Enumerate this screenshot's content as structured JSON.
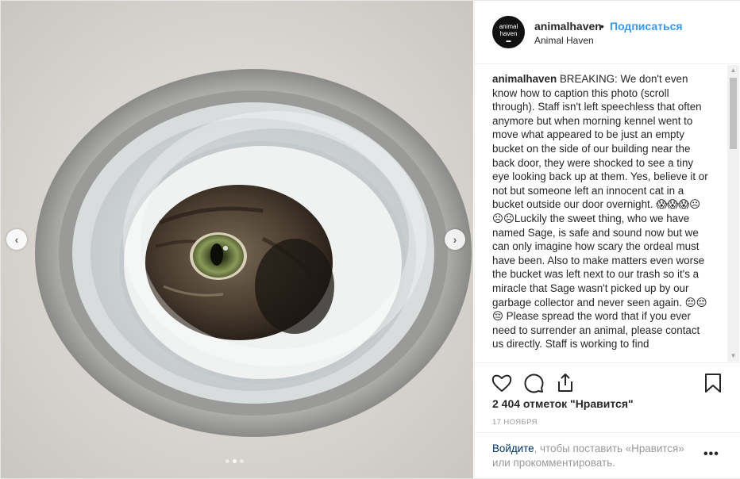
{
  "post": {
    "username": "animalhaven",
    "separator": "•",
    "follow_label": "Подписаться",
    "location": "Animal Haven",
    "avatar": {
      "line1": "animal",
      "line2": "haven",
      "line3": "▬"
    },
    "caption": {
      "user": "animalhaven",
      "text": " BREAKING: We don't even know how to caption this photo (scroll through). Staff isn't left speechless that often anymore but when morning kennel went to move what appeared to be just an empty bucket on the side of our building near the back door, they were shocked to see a tiny eye looking back up at them. Yes, believe it or not but someone left an innocent cat in a bucket outside our door overnight. 😱😱😱☹☹☹Luckily the sweet thing, who we have named Sage, is safe and sound now but we can only imagine how scary the ordeal must have been. Also to make matters even worse the bucket was left next to our trash so it's a miracle that Sage wasn't picked up by our garbage collector and never seen again. 😔😔😔 Please spread the word that if you ever need to surrender an animal, please contact us directly. Staff is working to find"
    },
    "likes": "2 404 отметок \"Нравится\"",
    "date": "17 НОЯБРЯ",
    "login": {
      "link": "Войдите",
      "rest": ", чтобы поставить «Нравится» или прокомментировать."
    },
    "more": "•••"
  },
  "carousel": {
    "prev": "‹",
    "next": "›",
    "slide_count": 3,
    "active_slide": 2
  },
  "icons": {
    "like": "heart-icon",
    "comment": "comment-icon",
    "share": "share-icon",
    "save": "bookmark-icon",
    "scroll_up": "▲",
    "scroll_down": "▼"
  },
  "colors": {
    "accent": "#3897f0",
    "link": "#003569",
    "muted": "#999999"
  }
}
